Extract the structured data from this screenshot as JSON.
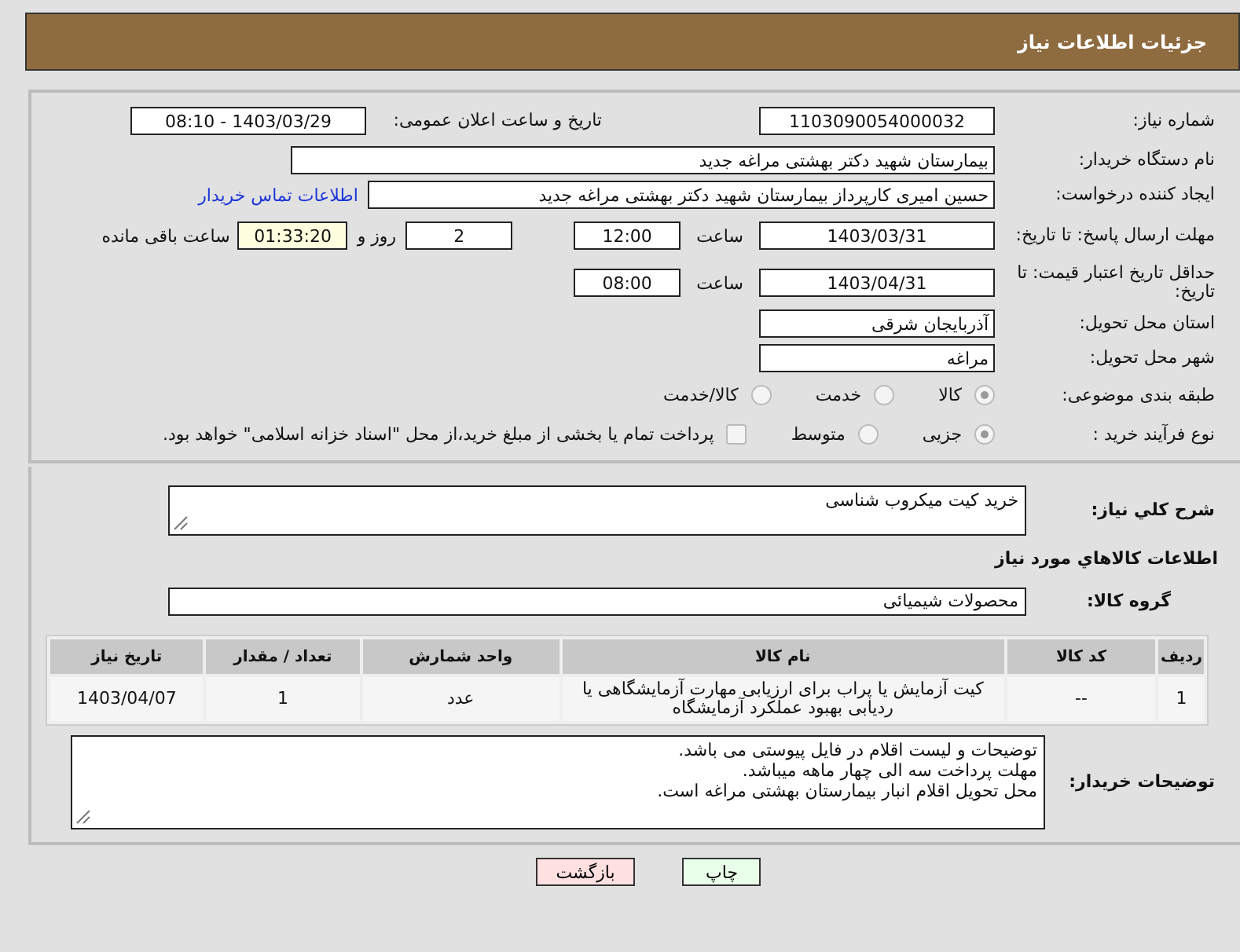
{
  "header": {
    "title": "جزئیات اطلاعات نیاز"
  },
  "need_number": {
    "label": "شماره نیاز:",
    "value": "1103090054000032"
  },
  "announce": {
    "label": "تاریخ و ساعت اعلان عمومی:",
    "value": "1403/03/29 - 08:10"
  },
  "buyer_org": {
    "label": "نام دستگاه خریدار:",
    "value": "بیمارستان شهید دکتر بهشتی مراغه جدید"
  },
  "creator": {
    "label": "ایجاد کننده درخواست:",
    "value": "حسین امیری کارپرداز بیمارستان شهید دکتر بهشتی مراغه جدید",
    "link": "اطلاعات تماس خریدار"
  },
  "deadline": {
    "label": "مهلت ارسال پاسخ: تا تاریخ:",
    "date": "1403/03/31",
    "time_label": "ساعت",
    "time": "12:00",
    "days": "2",
    "days_label": "روز و",
    "remaining": "01:33:20",
    "remaining_label": "ساعت باقی مانده"
  },
  "validity": {
    "label": "حداقل تاریخ اعتبار قیمت: تا تاریخ:",
    "date": "1403/04/31",
    "time_label": "ساعت",
    "time": "08:00"
  },
  "province": {
    "label": "استان محل تحویل:",
    "value": "آذربایجان شرقی"
  },
  "city": {
    "label": "شهر محل تحویل:",
    "value": "مراغه"
  },
  "category": {
    "label": "طبقه بندی موضوعی:",
    "options": [
      {
        "label": "کالا",
        "selected": true
      },
      {
        "label": "خدمت",
        "selected": false
      },
      {
        "label": "کالا/خدمت",
        "selected": false
      }
    ]
  },
  "process": {
    "label": "نوع فرآیند خرید :",
    "options": [
      {
        "label": "جزیی",
        "selected": true
      },
      {
        "label": "متوسط",
        "selected": false
      }
    ],
    "treasury": {
      "label": "پرداخت تمام یا بخشی از مبلغ خرید،از محل \"اسناد خزانه اسلامی\" خواهد بود.",
      "checked": false
    }
  },
  "summary": {
    "label": "شرح کلي نياز:",
    "value": "خرید کیت میکروب شناسی"
  },
  "goods_heading": "اطلاعات کالاهاي مورد نياز",
  "goods_group": {
    "label": "گروه کالا:",
    "value": "محصولات شیمیائی"
  },
  "table": {
    "columns": [
      "ردیف",
      "کد کالا",
      "نام کالا",
      "واحد شمارش",
      "تعداد / مقدار",
      "تاریخ نیاز"
    ],
    "rows": [
      [
        "1",
        "--",
        "کیت آزمایش یا پراب برای ارزیابی مهارت آزمایشگاهی یا ردیابی بهبود عملکرد آزمایشگاه",
        "عدد",
        "1",
        "1403/04/07"
      ]
    ]
  },
  "buyer_notes": {
    "label": "توضیحات خریدار:",
    "lines": [
      "توضیحات و لیست اقلام در فایل پیوستی می باشد.",
      "مهلت پرداخت سه الی چهار ماهه میباشد.",
      "محل تحویل اقلام انبار بیمارستان بهشتی مراغه است."
    ]
  },
  "buttons": {
    "print": "چاپ",
    "back": "بازگشت"
  }
}
